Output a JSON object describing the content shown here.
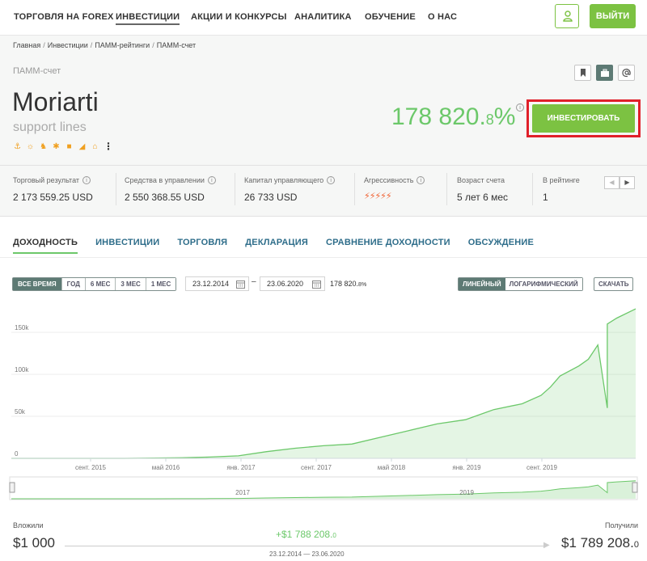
{
  "nav": {
    "items": [
      "ТОРГОВЛЯ НА FOREX",
      "ИНВЕСТИЦИИ",
      "АКЦИИ И КОНКУРСЫ",
      "АНАЛИТИКА",
      "ОБУЧЕНИЕ",
      "О НАС"
    ],
    "active_item": "ИНВЕСТИЦИИ",
    "user_icon": "user-icon",
    "logout_label": "ВЫЙТИ",
    "accent_color": "#7cc242"
  },
  "breadcrumb": [
    "Главная",
    "Инвестиции",
    "ПАММ-рейтинги",
    "ПАММ-счет"
  ],
  "account": {
    "type_label": "ПАММ-счет",
    "name": "Moriarti",
    "strategy": "support lines",
    "badge_icons": [
      "anchor-icon",
      "sun-icon",
      "walker-icon",
      "sparkle-icon",
      "lock-icon",
      "stairs-icon",
      "house-icon"
    ],
    "return_main": "178 820.",
    "return_decimal": "8",
    "return_percent": "%",
    "invest_label": "ИНВЕСТИРОВАТЬ",
    "action_icons": [
      "bookmark-icon",
      "briefcase-icon",
      "at-icon"
    ]
  },
  "stats": [
    {
      "label": "Торговый результат",
      "value": "2 173 559.25 USD",
      "info": true
    },
    {
      "label": "Средства в управлении",
      "value": "2 550 368.55 USD",
      "info": true
    },
    {
      "label": "Капитал управляющего",
      "value": "26 733 USD",
      "info": true
    },
    {
      "label": "Агрессивность",
      "value": "⚡⚡⚡⚡⚡",
      "info": true
    },
    {
      "label": "Возраст счета",
      "value": "5 лет 6 мес",
      "info": false
    },
    {
      "label": "В рейтинге",
      "value": "1",
      "info": false
    }
  ],
  "tabs": [
    "ДОХОДНОСТЬ",
    "ИНВЕСТИЦИИ",
    "ТОРГОВЛЯ",
    "ДЕКЛАРАЦИЯ",
    "СРАВНЕНИЕ ДОХОДНОСТИ",
    "ОБСУЖДЕНИЕ"
  ],
  "controls": {
    "periods": [
      "ВСЕ ВРЕМЯ",
      "ГОД",
      "6 МЕС",
      "3 МЕС",
      "1 МЕС"
    ],
    "active_period": "ВСЕ ВРЕМЯ",
    "date_from": "23.12.2014",
    "date_to": "23.06.2020",
    "range_return_main": "178 820.",
    "range_return_small": "8%",
    "scales": [
      "ЛИНЕЙНЫЙ",
      "ЛОГАРИФМИЧЕСКИЙ"
    ],
    "active_scale": "ЛИНЕЙНЫЙ",
    "download_label": "СКАЧАТЬ"
  },
  "chart_data": {
    "type": "area",
    "y_ticks": [
      "0",
      "50k",
      "100k",
      "150k"
    ],
    "ylim": [
      0,
      180000
    ],
    "x_ticks": [
      "сент. 2015",
      "май 2016",
      "янв. 2017",
      "сент. 2017",
      "май 2018",
      "янв. 2019",
      "сент. 2019"
    ],
    "navigator_ticks": [
      "2017",
      "2019"
    ],
    "color": "#6cc86a",
    "x": [
      "2014-12",
      "2015-03",
      "2015-06",
      "2015-09",
      "2015-12",
      "2016-03",
      "2016-06",
      "2016-09",
      "2016-12",
      "2017-03",
      "2017-06",
      "2017-09",
      "2017-12",
      "2018-03",
      "2018-06",
      "2018-09",
      "2018-12",
      "2019-03",
      "2019-06",
      "2019-08",
      "2019-09",
      "2019-10",
      "2019-12",
      "2020-01",
      "2020-02",
      "2020-03",
      "2020-03",
      "2020-04",
      "2020-06"
    ],
    "series": [
      {
        "values": [
          0,
          0,
          0,
          0,
          0,
          300,
          700,
          1500,
          3000,
          8000,
          12000,
          15000,
          17000,
          25000,
          33000,
          41000,
          46000,
          58000,
          65000,
          75000,
          85000,
          98000,
          110000,
          118000,
          135000,
          60000,
          160000,
          167000,
          178000
        ]
      }
    ]
  },
  "summary": {
    "invested_label": "Вложили",
    "invested_value": "$1 000",
    "received_label": "Получили",
    "received_main": "$1 789 208.",
    "received_small": "0",
    "profit_main": "+$1 788 208.",
    "profit_small": "0",
    "period": "23.12.2014 — 23.06.2020"
  }
}
